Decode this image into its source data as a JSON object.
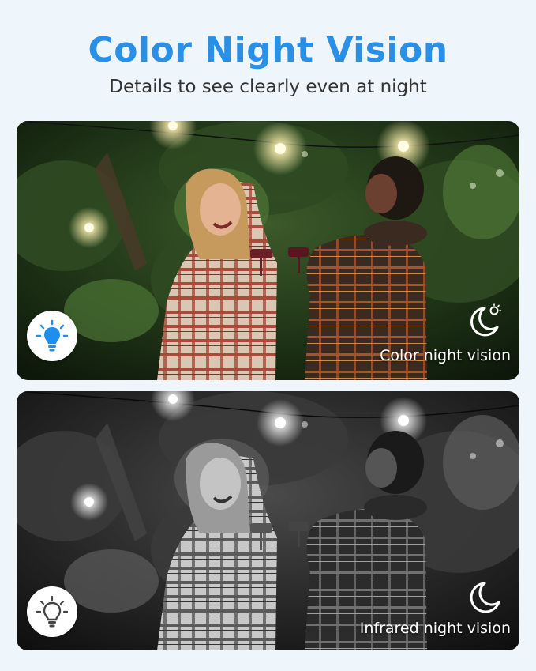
{
  "header": {
    "title": "Color Night Vision",
    "subtitle": "Details to see clearly even at night"
  },
  "colors": {
    "title": "#2a8fe6",
    "bulb_on": "#1f8ef1",
    "bulb_off": "#444444",
    "background": "#eef5fb"
  },
  "panels": [
    {
      "mode_label": "Color night vision",
      "bulb_icon": "lightbulb-on-icon",
      "mode_icon": "moon-sun-icon"
    },
    {
      "mode_label": "Infrared night vision",
      "bulb_icon": "lightbulb-off-icon",
      "mode_icon": "moon-icon"
    }
  ]
}
